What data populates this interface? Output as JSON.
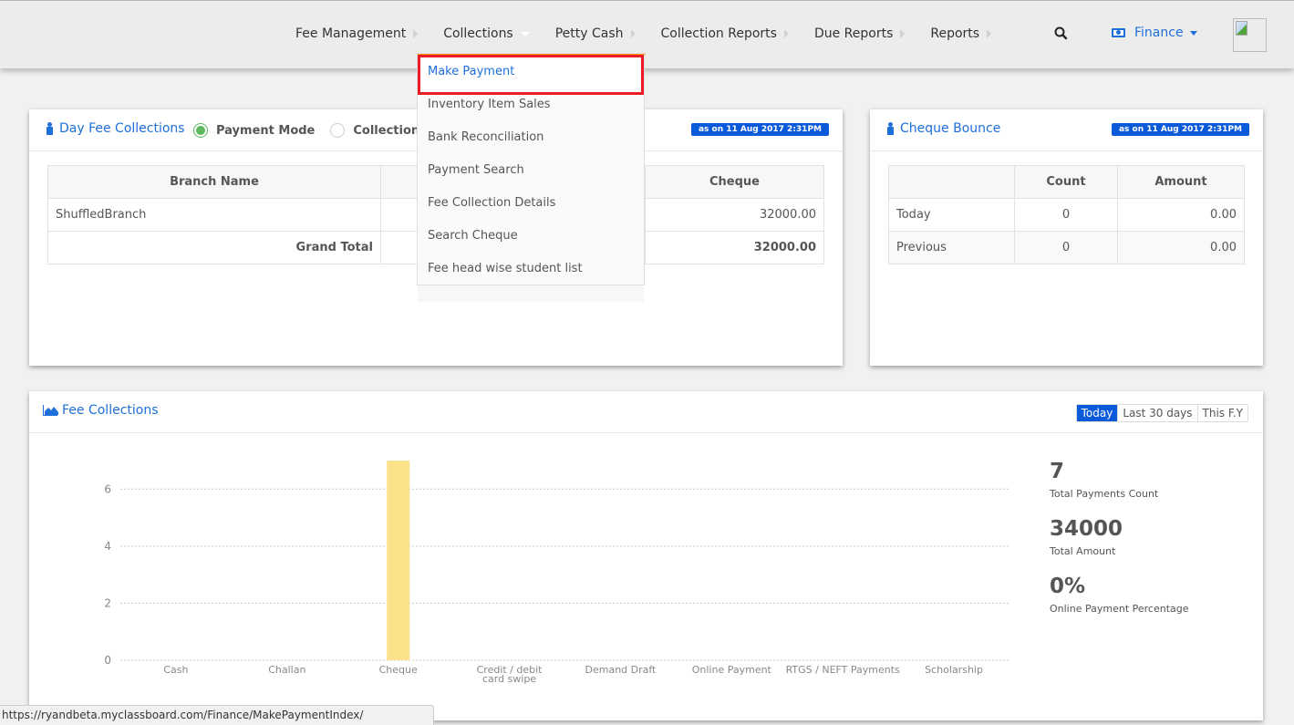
{
  "nav": {
    "items": [
      {
        "label": "Fee Management",
        "caret": "right"
      },
      {
        "label": "Collections",
        "caret": "down"
      },
      {
        "label": "Petty Cash",
        "caret": "right"
      },
      {
        "label": "Collection Reports",
        "caret": "right"
      },
      {
        "label": "Due Reports",
        "caret": "right"
      },
      {
        "label": "Reports",
        "caret": "right"
      }
    ],
    "search_icon": "search-icon",
    "module_label": "Finance",
    "module_icon": "money-icon",
    "avatar_icon": "broken-image-icon"
  },
  "collections_menu": {
    "items": [
      {
        "label": "Make Payment",
        "active": true
      },
      {
        "label": "Inventory Item Sales"
      },
      {
        "label": "Bank Reconciliation"
      },
      {
        "label": "Payment Search"
      },
      {
        "label": "Fee Collection Details"
      },
      {
        "label": "Search Cheque"
      },
      {
        "label": "Fee head wise student list"
      }
    ],
    "highlight_color": "#ed1c24"
  },
  "day_fee": {
    "title": "Day Fee Collections",
    "radio_payment_mode": "Payment Mode",
    "radio_collections": "Collections (7",
    "selected": "Payment Mode",
    "badge": "as on 11 Aug 2017 2:31PM",
    "table": {
      "headers": [
        "Branch Name",
        "",
        "Cheque"
      ],
      "rows": [
        [
          "ShuffledBranch",
          "",
          "32000.00"
        ]
      ],
      "total": [
        "Grand Total",
        "",
        "32000.00"
      ]
    }
  },
  "cheque_bounce": {
    "title": "Cheque Bounce",
    "badge": "as on 11 Aug 2017 2:31PM",
    "table": {
      "headers": [
        "",
        "Count",
        "Amount"
      ],
      "rows": [
        [
          "Today",
          "0",
          "0.00"
        ],
        [
          "Previous",
          "0",
          "0.00"
        ]
      ]
    }
  },
  "fee_collections": {
    "title": "Fee Collections",
    "periods": [
      "Today",
      "Last 30 days",
      "This F.Y"
    ],
    "active_period": "Today",
    "stats": [
      {
        "value": "7",
        "label": "Total Payments Count"
      },
      {
        "value": "34000",
        "label": "Total Amount"
      },
      {
        "value": "0%",
        "label": "Online Payment Percentage"
      }
    ]
  },
  "chart_data": {
    "type": "bar",
    "title": "",
    "xlabel": "",
    "ylabel": "",
    "categories": [
      "Cash",
      "Challan",
      "Cheque",
      "Credit / debit card swipe",
      "Demand Draft",
      "Online Payment",
      "RTGS / NEFT Payments",
      "Scholarship"
    ],
    "values": [
      0,
      0,
      7,
      0,
      0,
      0,
      0,
      0
    ],
    "yticks": [
      0,
      2,
      4,
      6
    ],
    "ylim": [
      0,
      7
    ],
    "grid": true,
    "bar_color": "#fbe18a"
  },
  "statusbar": {
    "url": "https://ryandbeta.myclassboard.com/Finance/MakePaymentIndex/"
  }
}
